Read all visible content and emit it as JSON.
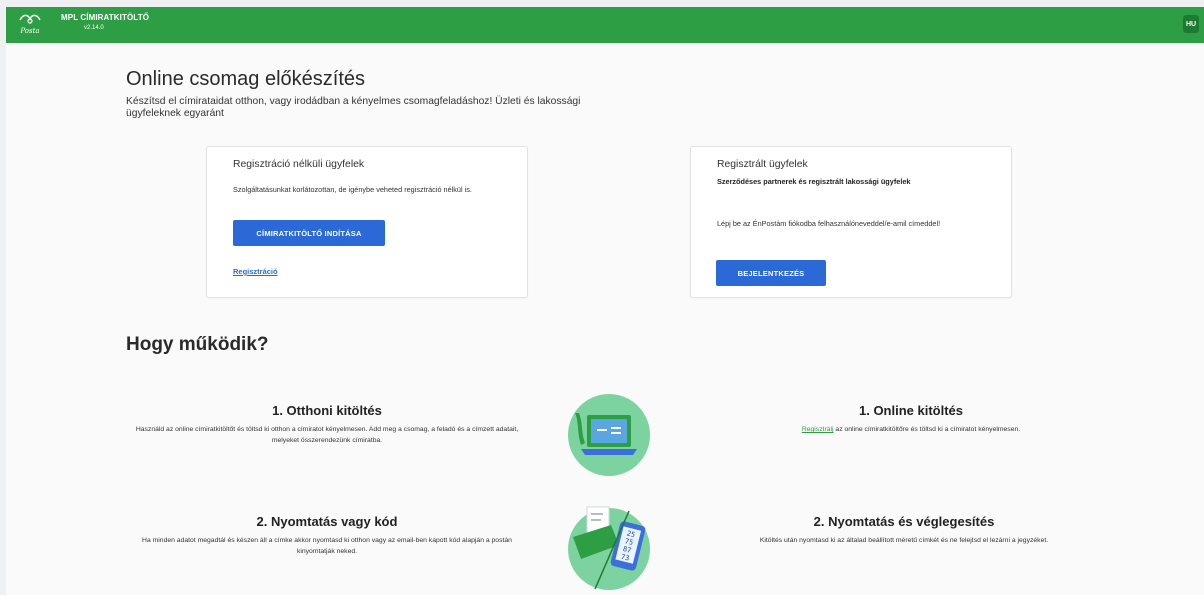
{
  "header": {
    "logo_text": "Posta",
    "app_title": "MPL CÍMIRATKITÖLTŐ",
    "version": "v2.14.0",
    "lang": "HU"
  },
  "hero": {
    "title": "Online csomag előkészítés",
    "description": "Készítsd el címirataidat otthon, vagy irodádban a kényelmes csomagfeladáshoz! Üzleti és lakossági ügyfeleknek egyaránt"
  },
  "card_unregistered": {
    "title": "Regisztráció nélküli ügyfelek",
    "text": "Szolgáltatásunkat korlátozottan, de igénybe veheted regisztráció nélkül is.",
    "button": "CÍMIRATKITÖLTŐ INDÍTÁSA",
    "link": "Regisztráció"
  },
  "card_registered": {
    "title": "Regisztrált ügyfelek",
    "subtitle": "Szerződéses partnerek és regisztrált lakossági ügyfelek",
    "text": "Lépj be az ÉnPostám fiókodba felhasználóneveddel/e-amil címeddel!",
    "button": "BEJELENTKEZÉS"
  },
  "how": {
    "title": "Hogy működik?",
    "left": [
      {
        "title": "1. Otthoni kitöltés",
        "text": "Használd az online címiratkitöltőt és töltsd ki otthon a címiratot kényelmesen. Add meg a csomag, a feladó és a címzett adatait, melyeket összerendezünk címiratba."
      },
      {
        "title": "2. Nyomtatás vagy kód",
        "text": "Ha minden adatot megadtál és készen áll a címke akkor nyomtasd ki otthon vagy az email-ben kapott kód alapján a postán kinyomtatják neked."
      }
    ],
    "right": [
      {
        "title": "1. Online kitöltés",
        "link": "Regisztrálj",
        "text": " az online címiratkitöltőre és töltsd ki a címiratot kényelmesen."
      },
      {
        "title": "2. Nyomtatás és véglegesítés",
        "text": "Kitöltés után nyomtasd ki az általad beállított méretű címkét és ne felejtsd el lezárni a jegyzéket."
      }
    ],
    "phone_code": [
      "25",
      "75",
      "87",
      "73"
    ]
  },
  "colors": {
    "header_green": "#2e9e44",
    "button_blue": "#2b6ad6",
    "illustration_green": "#7dd3a0"
  }
}
